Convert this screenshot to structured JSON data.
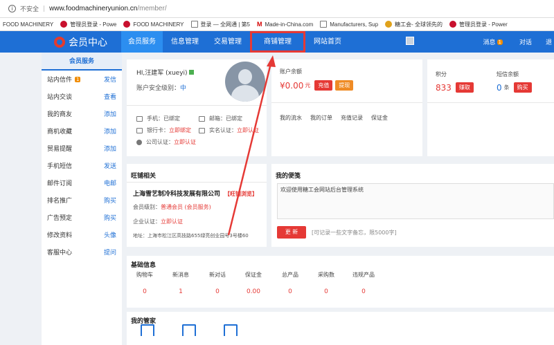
{
  "browser": {
    "unsafe_label": "不安全",
    "url_domain": "www.foodmachineryunion.cn",
    "url_path": "/member/",
    "bookmarks": [
      {
        "label": "FOOD MACHINERY",
        "icon": "none"
      },
      {
        "label": "管理员登录 - Powe",
        "icon": "red-globe-icon"
      },
      {
        "label": "FOOD MACHINERY",
        "icon": "red-globe-icon"
      },
      {
        "label": "登录 — 全网通 | 第5",
        "icon": "document-icon"
      },
      {
        "label": "Made-in-China.com",
        "icon": "mic-icon"
      },
      {
        "label": "Manufacturers, Sup",
        "icon": "document-icon"
      },
      {
        "label": "糖工会- 全球领先的",
        "icon": "gold-icon"
      },
      {
        "label": "管理员登录 - Power",
        "icon": "red-globe-icon"
      }
    ]
  },
  "topnav": {
    "logo_text": "会员中心",
    "items": [
      "会员服务",
      "信息管理",
      "交易管理",
      "商铺管理",
      "网站首页"
    ],
    "active_index": 0,
    "highlighted_index": 3,
    "messages_label": "消息",
    "messages_count": "1",
    "chat_label": "对话",
    "exit_label": "退"
  },
  "sidebar": {
    "title": "会员服务",
    "items": [
      {
        "label": "站内信件",
        "badge": "1",
        "action": "发信"
      },
      {
        "label": "站内交谈",
        "badge": "",
        "action": "查看"
      },
      {
        "label": "我的商友",
        "badge": "",
        "action": "添加"
      },
      {
        "label": "商机收藏",
        "badge": "",
        "action": "添加"
      },
      {
        "label": "贸易提醒",
        "badge": "",
        "action": "添加"
      },
      {
        "label": "手机短信",
        "badge": "",
        "action": "发送"
      },
      {
        "label": "邮件订阅",
        "badge": "",
        "action": "电邮"
      },
      {
        "label": "排名推广",
        "badge": "",
        "action": "购买"
      },
      {
        "label": "广告预定",
        "badge": "",
        "action": "购买"
      },
      {
        "label": "修改资料",
        "badge": "",
        "action": "头像"
      },
      {
        "label": "客服中心",
        "badge": "",
        "action": "提问"
      }
    ]
  },
  "user": {
    "greeting": "HI,汪建军 (xueyi)",
    "level_label": "账户安全级别：",
    "level_value": "中",
    "phone": "手机：已绑定",
    "email": "邮箱：已绑定",
    "bank_label": "银行卡：",
    "bank_value": "立即绑定",
    "realname_label": "实名认证：",
    "realname_value": "立即认证",
    "company_label": "公司认证：",
    "company_value": "立即认证"
  },
  "account": {
    "label": "账户余额",
    "amount": "¥0.00",
    "unit": "元",
    "recharge": "充值",
    "withdraw": "提现",
    "links": [
      "我的流水",
      "我的订单",
      "充值记录",
      "保证金"
    ]
  },
  "points": {
    "label": "积分",
    "value": "833",
    "btn": "赚取",
    "sms_label": "短信余额",
    "sms_value": "0",
    "sms_unit": "条",
    "sms_btn": "购买"
  },
  "wangpu": {
    "title": "旺铺相关",
    "company": "上海雪艺制冷科技发展有限公司",
    "tag": "【旺铺浏览】",
    "member_level_label": "会员级别：",
    "member_level_value": "普通会员 (会员服务)",
    "cert_label": "企业认证：",
    "cert_value": "立即认证",
    "address": "地址：上海市松江区高技路655绿亮创业园号3号楼60"
  },
  "notes": {
    "title": "我的便笺",
    "content": "欢迎使用糖工会网站后台管理系统",
    "update_btn": "更 新",
    "hint": "[可记录一些文字备忘，限5000字]"
  },
  "basic": {
    "title": "基础信息",
    "stats": [
      {
        "label": "购物车",
        "value": "0"
      },
      {
        "label": "新消息",
        "value": "1"
      },
      {
        "label": "新对话",
        "value": "0"
      },
      {
        "label": "保证金",
        "value": "0.00"
      },
      {
        "label": "总产品",
        "value": "0"
      },
      {
        "label": "采购数",
        "value": "0"
      },
      {
        "label": "违规产品",
        "value": "0"
      }
    ]
  },
  "manager": {
    "title": "我的管家",
    "icons": [
      "edit-icon",
      "clipboard-check-icon",
      "shop-settings-icon"
    ]
  },
  "colors": {
    "brand_blue": "#1e6fd5",
    "accent_red": "#e53935",
    "badge_orange": "#f08c00"
  }
}
